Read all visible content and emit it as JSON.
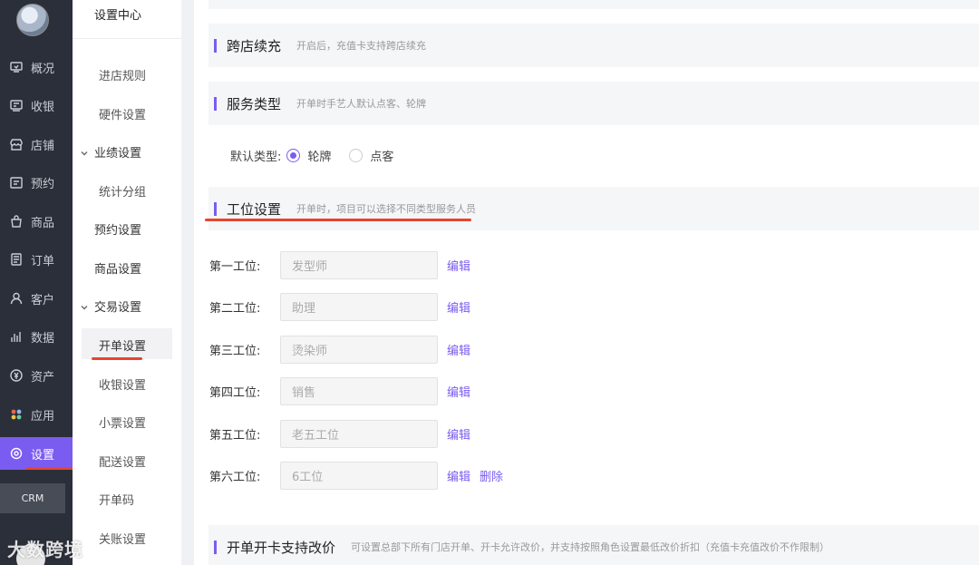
{
  "nav": {
    "items": [
      {
        "label": "概况",
        "icon": "overview-icon"
      },
      {
        "label": "收银",
        "icon": "cashier-icon"
      },
      {
        "label": "店铺",
        "icon": "store-icon"
      },
      {
        "label": "预约",
        "icon": "appointment-icon"
      },
      {
        "label": "商品",
        "icon": "goods-icon"
      },
      {
        "label": "订单",
        "icon": "order-icon"
      },
      {
        "label": "客户",
        "icon": "customer-icon"
      },
      {
        "label": "数据",
        "icon": "data-icon"
      },
      {
        "label": "资产",
        "icon": "asset-icon"
      },
      {
        "label": "应用",
        "icon": "apps-icon"
      },
      {
        "label": "设置",
        "icon": "settings-icon",
        "active": true
      }
    ],
    "crm": "CRM"
  },
  "subnav": {
    "title": "设置中心",
    "items": [
      "进店规则",
      "硬件设置",
      "业绩设置",
      "统计分组",
      "预约设置",
      "商品设置",
      "交易设置",
      "开单设置",
      "收银设置",
      "小票设置",
      "配送设置",
      "开单码",
      "关账设置"
    ]
  },
  "sections": {
    "cross_store": {
      "title": "跨店续充",
      "desc": "开启后，充值卡支持跨店续充"
    },
    "service_type": {
      "title": "服务类型",
      "desc": "开单时手艺人默认点客、轮牌"
    },
    "default_type": {
      "label": "默认类型:",
      "options": [
        "轮牌",
        "点客"
      ],
      "selected": "轮牌"
    },
    "positions": {
      "title": "工位设置",
      "desc": "开单时，项目可以选择不同类型服务人员"
    },
    "price_change": {
      "title": "开单开卡支持改价",
      "desc": "可设置总部下所有门店开单、开卡允许改价，并支持按照角色设置最低改价折扣（充值卡充值改价不作限制）"
    }
  },
  "positions": [
    {
      "label": "第一工位:",
      "placeholder": "发型师",
      "edit": "编辑"
    },
    {
      "label": "第二工位:",
      "placeholder": "助理",
      "edit": "编辑"
    },
    {
      "label": "第三工位:",
      "placeholder": "烫染师",
      "edit": "编辑"
    },
    {
      "label": "第四工位:",
      "placeholder": "销售",
      "edit": "编辑"
    },
    {
      "label": "第五工位:",
      "placeholder": "老五工位",
      "edit": "编辑"
    },
    {
      "label": "第六工位:",
      "placeholder": "6工位",
      "edit": "编辑",
      "delete": "删除"
    }
  ],
  "watermark": "大数跨境",
  "colors": {
    "accent": "#7b5cf0",
    "nav_bg": "#2b2f3a",
    "annotation": "#e8442e"
  }
}
